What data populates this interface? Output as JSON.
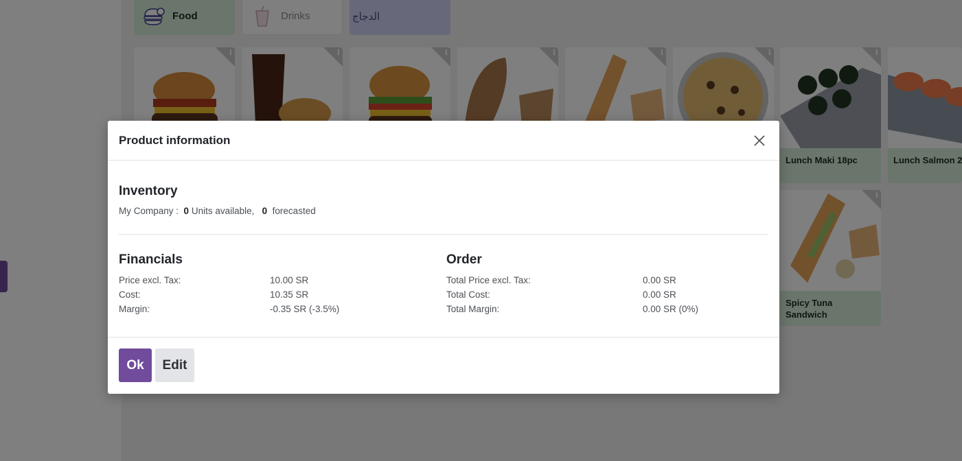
{
  "categories": [
    {
      "label": "Food",
      "icon": "burger-icon"
    },
    {
      "label": "Drinks",
      "icon": "drink-cup-icon"
    },
    {
      "label": "الدجاج"
    }
  ],
  "products": [
    {
      "image": "burger-bacon-image"
    },
    {
      "image": "cola-burger-image"
    },
    {
      "image": "cheeseburger-image"
    },
    {
      "image": "bread-sandwich-image"
    },
    {
      "image": "baguette-sandwich-image"
    },
    {
      "image": "pizza-image"
    },
    {
      "name": "Lunch Maki 18pc",
      "image": "maki-rolls-image"
    },
    {
      "name": "Lunch Salmon 2",
      "image": "salmon-sushi-image"
    },
    {
      "name": "Spicy Tuna Sandwich",
      "image": "tuna-sandwich-image"
    }
  ],
  "modal": {
    "title": "Product information",
    "close_icon": "close-icon",
    "inventory": {
      "title": "Inventory",
      "company": "My Company :",
      "units_available_value": "0",
      "units_available_label": "Units available,",
      "forecasted_value": "0",
      "forecasted_label": "forecasted"
    },
    "financials": {
      "title": "Financials",
      "rows": [
        {
          "label": "Price excl. Tax:",
          "value": "10.00 SR"
        },
        {
          "label": "Cost:",
          "value": "10.35 SR"
        },
        {
          "label": "Margin:",
          "value": "-0.35 SR (-3.5%)"
        }
      ]
    },
    "order": {
      "title": "Order",
      "rows": [
        {
          "label": "Total Price excl. Tax:",
          "value": "0.00 SR"
        },
        {
          "label": "Total Cost:",
          "value": "0.00 SR"
        },
        {
          "label": "Total Margin:",
          "value": "0.00 SR (0%)"
        }
      ]
    },
    "buttons": {
      "ok": "Ok",
      "edit": "Edit"
    }
  },
  "colors": {
    "primary": "#714b9c",
    "food_category": "#d4edd7",
    "chicken_category": "#cfd0f4"
  }
}
